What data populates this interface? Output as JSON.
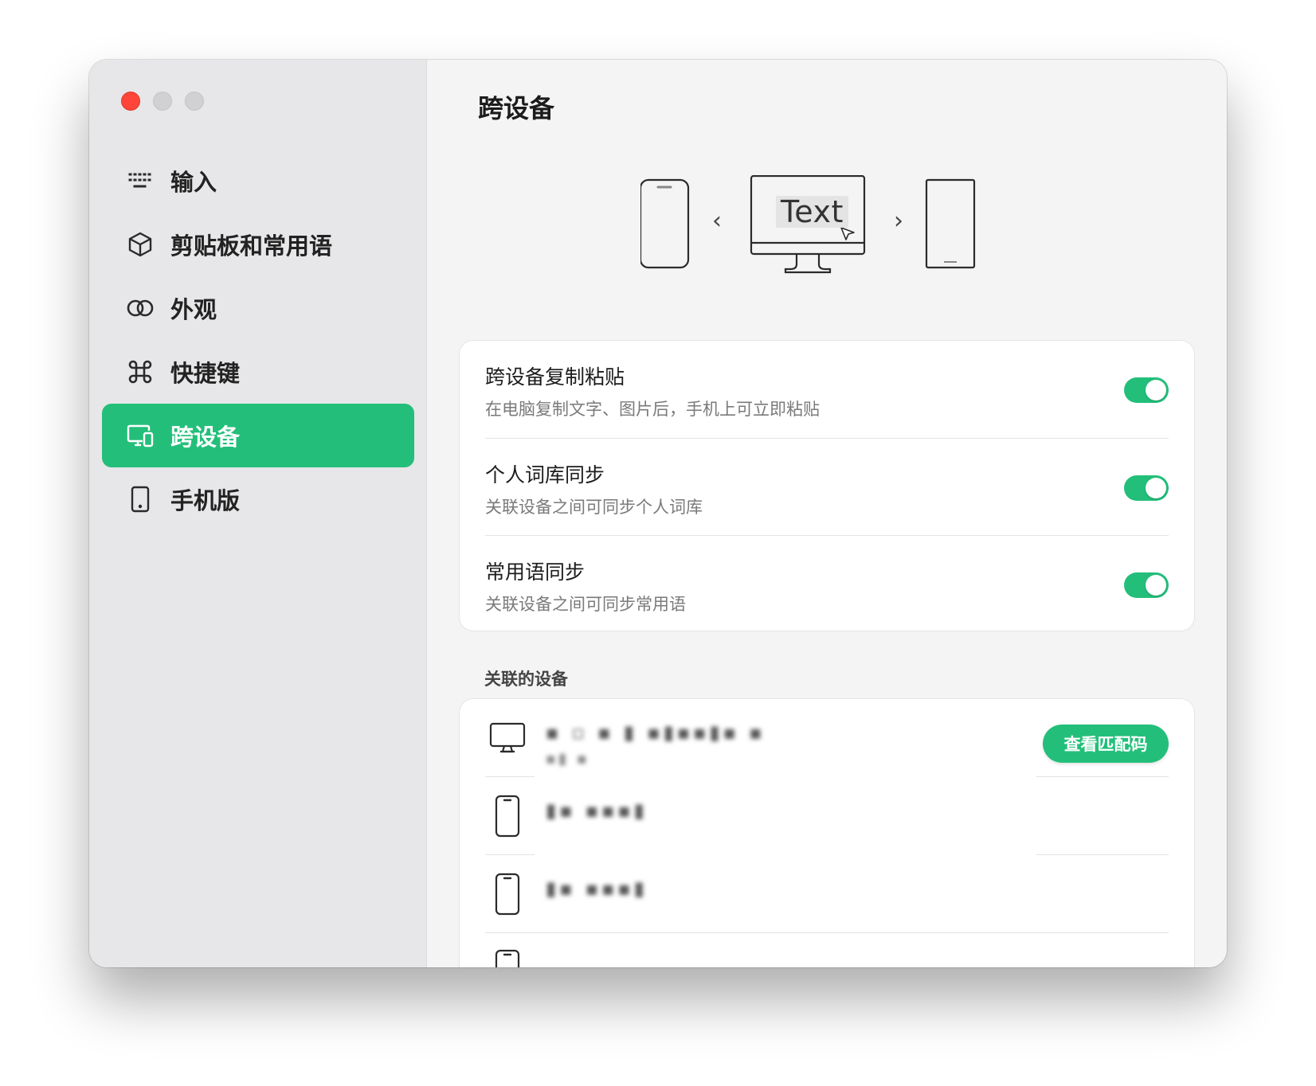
{
  "window": {
    "traffic_lights": [
      "close",
      "minimize",
      "maximize"
    ]
  },
  "sidebar": {
    "items": [
      {
        "label": "输入",
        "icon": "keyboard-icon",
        "active": false
      },
      {
        "label": "剪贴板和常用语",
        "icon": "cube-icon",
        "active": false
      },
      {
        "label": "外观",
        "icon": "rings-icon",
        "active": false
      },
      {
        "label": "快捷键",
        "icon": "command-icon",
        "active": false
      },
      {
        "label": "跨设备",
        "icon": "devices-icon",
        "active": true
      },
      {
        "label": "手机版",
        "icon": "phone-icon",
        "active": false
      }
    ]
  },
  "main": {
    "title": "跨设备",
    "illustration": {
      "text": "Text",
      "left_arrow": "‹",
      "right_arrow": "›"
    },
    "settings": [
      {
        "title": "跨设备复制粘贴",
        "desc": "在电脑复制文字、图片后，手机上可立即粘贴",
        "enabled": true
      },
      {
        "title": "个人词库同步",
        "desc": "关联设备之间可同步个人词库",
        "enabled": true
      },
      {
        "title": "常用语同步",
        "desc": "关联设备之间可同步常用语",
        "enabled": true
      }
    ],
    "devices_section": {
      "label": "关联的设备",
      "match_button": "查看匹配码",
      "devices": [
        {
          "type": "desktop-icon",
          "name": "▪ ▫ ▪ ▮ ▪▮▪▪▮▪ ▪",
          "sub": "▪▮ ▪"
        },
        {
          "type": "phone-icon",
          "name": "▮▪ ▪▪▪▮"
        },
        {
          "type": "phone-icon",
          "name": "▮▪ ▪▪▪▮"
        }
      ]
    }
  },
  "colors": {
    "accent": "#23bf7a",
    "sidebar_bg": "#e7e6e8",
    "content_bg": "#f4f4f4",
    "close_button": "#ff453a"
  }
}
